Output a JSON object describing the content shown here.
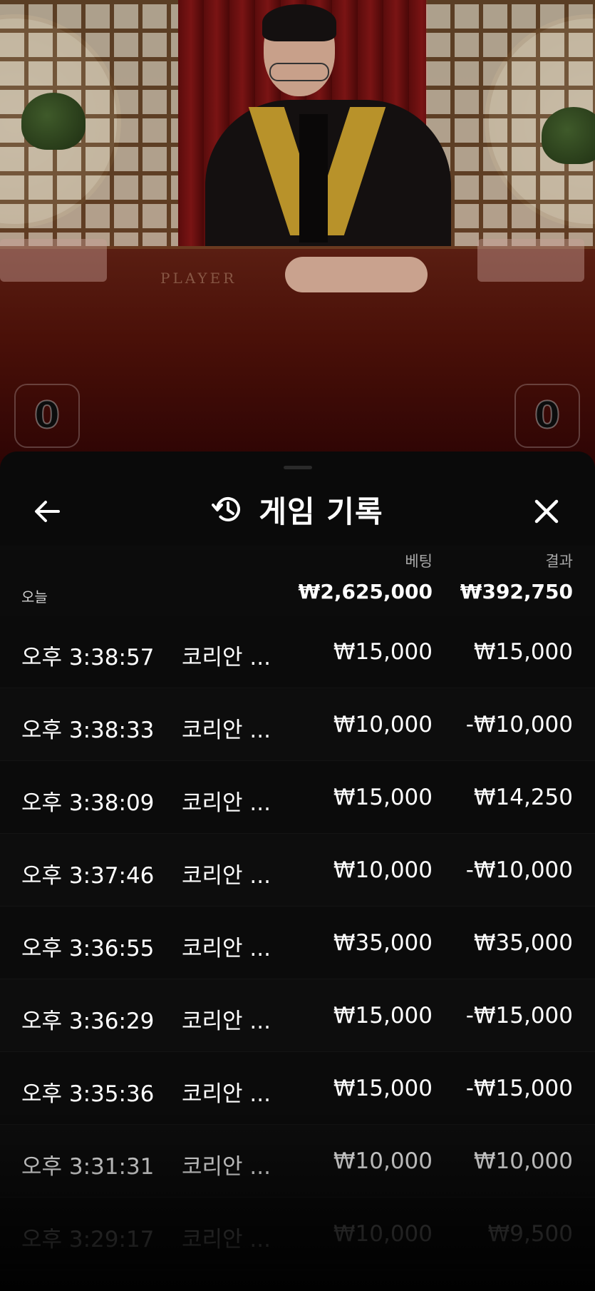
{
  "video": {
    "table_label": "PLAYER",
    "player_score": "0",
    "banker_score": "0"
  },
  "panel": {
    "title": "게임 기록",
    "icons": {
      "back": "arrow-left-icon",
      "history": "history-icon",
      "close": "close-icon"
    }
  },
  "columns": {
    "bet": "베팅",
    "result": "결과"
  },
  "summary": {
    "label": "오늘",
    "bet": "₩2,625,000",
    "result": "₩392,750"
  },
  "rows": [
    {
      "time": "오후 3:38:57",
      "game": "코리안 ...",
      "bet": "₩15,000",
      "result": "₩15,000"
    },
    {
      "time": "오후 3:38:33",
      "game": "코리안 ...",
      "bet": "₩10,000",
      "result": "-₩10,000"
    },
    {
      "time": "오후 3:38:09",
      "game": "코리안 ...",
      "bet": "₩15,000",
      "result": "₩14,250"
    },
    {
      "time": "오후 3:37:46",
      "game": "코리안 ...",
      "bet": "₩10,000",
      "result": "-₩10,000"
    },
    {
      "time": "오후 3:36:55",
      "game": "코리안 ...",
      "bet": "₩35,000",
      "result": "₩35,000"
    },
    {
      "time": "오후 3:36:29",
      "game": "코리안 ...",
      "bet": "₩15,000",
      "result": "-₩15,000"
    },
    {
      "time": "오후 3:35:36",
      "game": "코리안 ...",
      "bet": "₩15,000",
      "result": "-₩15,000"
    },
    {
      "time": "오후 3:31:31",
      "game": "코리안 ...",
      "bet": "₩10,000",
      "result": "₩10,000"
    },
    {
      "time": "오후 3:29:17",
      "game": "코리안 ...",
      "bet": "₩10,000",
      "result": "₩9,500"
    }
  ]
}
